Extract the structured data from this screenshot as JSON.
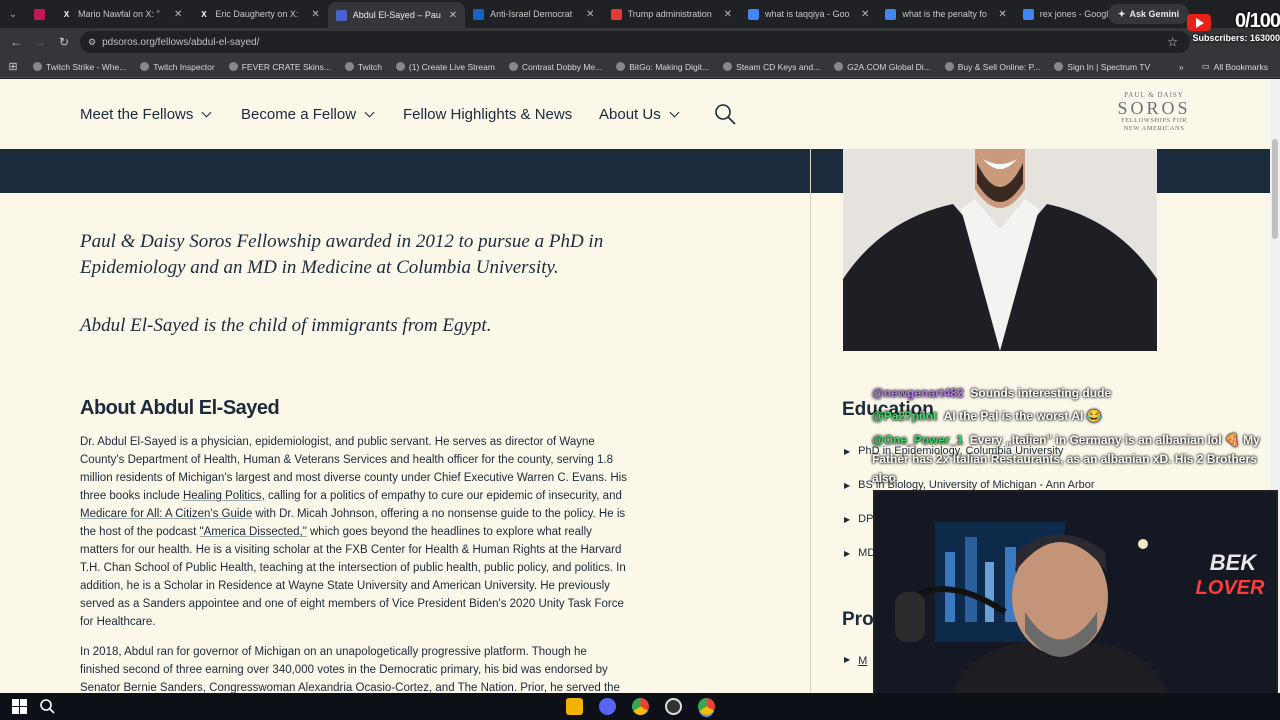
{
  "tabs": [
    {
      "label": "",
      "icon": "app-icon",
      "color": "#c2185b"
    },
    {
      "label": "Mario Nawfal on X: \"",
      "icon": "x-icon",
      "color": "#000000"
    },
    {
      "label": "Eric Daugherty on X:",
      "icon": "x-icon",
      "color": "#000000"
    },
    {
      "label": "Abdul El-Sayed – Pau",
      "icon": "pdsoros-icon",
      "color": "#4a63c7",
      "active": true
    },
    {
      "label": "Anti-Israel Democrat",
      "icon": "news-icon",
      "color": "#1565c0"
    },
    {
      "label": "Trump administration",
      "icon": "news-icon",
      "color": "#e53935"
    },
    {
      "label": "what is taqqiya - Goo",
      "icon": "google-icon",
      "color": "#4285f4"
    },
    {
      "label": "what is the penalty fo",
      "icon": "google-icon",
      "color": "#4285f4"
    },
    {
      "label": "rex jones - Google Se",
      "icon": "google-icon",
      "color": "#4285f4"
    }
  ],
  "gemini_label": "Ask Gemini",
  "url": "pdsoros.org/fellows/abdul-el-sayed/",
  "bookmarks": [
    "Twitch Strike - Whe...",
    "Twitch Inspector",
    "FEVER CRATE Skins...",
    "Twitch",
    "(1) Create Live Stream",
    "Contrast Dobby Me...",
    "BitGo: Making Digit...",
    "Steam CD Keys and...",
    "G2A.COM Global Di...",
    "Buy & Sell Online: P...",
    "Sign In | Spectrum TV"
  ],
  "all_bookmarks": "All Bookmarks",
  "site_nav": {
    "meet": "Meet the Fellows",
    "become": "Become a Fellow",
    "highlights": "Fellow Highlights & News",
    "about": "About Us"
  },
  "logo": {
    "top": "PAUL & DAISY",
    "main": "SOROS",
    "sub1": "FELLOWSHIPS FOR",
    "sub2": "NEW AMERICANS"
  },
  "main": {
    "quote1": "Paul & Daisy Soros Fellowship awarded in 2012 to pursue a PhD in Epidemiology and an MD in Medicine at Columbia University.",
    "quote2": "Abdul El-Sayed is the child of immigrants from Egypt.",
    "about_heading": "About Abdul El-Sayed",
    "p1_a": "Dr. Abdul El-Sayed is a physician, epidemiologist, and public servant. He serves as director of Wayne County's Department of Health, Human & Veterans Services and health officer for the county, serving 1.8 million residents of Michigan's largest and most diverse county under Chief Executive Warren C. Evans. His three books include ",
    "p1_link1": "Healing Politics",
    "p1_b": ", calling for a politics of empathy to cure our epidemic of insecurity, and ",
    "p1_link2": "Medicare for All: A Citizen's Guide",
    "p1_c": " with Dr. Micah Johnson, offering a no nonsense guide to the policy. He is the host of the podcast ",
    "p1_link3": "\"America Dissected,\"",
    "p1_d": " which goes beyond the headlines to explore what really matters for our health. He is a visiting scholar at the FXB Center for Health & Human Rights at the Harvard T.H. Chan School of Public Health, teaching at the intersection of public health, public policy, and politics. In addition, he is a Scholar in Residence at Wayne State University and American University. He previously served as a Sanders appointee and one of eight members of Vice President Biden's 2020 Unity Task Force for Healthcare.",
    "p2": "In 2018, Abdul ran for governor of Michigan on an unapologetically progressive platform. Though he finished second of three earning over 340,000 votes in the Democratic primary, his bid was endorsed by Senator Bernie Sanders, Congresswoman Alexandria Ocasio-Cortez, and The Nation. Prior, he served the"
  },
  "sidebar": {
    "education_heading": "Education",
    "education": [
      "PhD in Epidemiology, Columbia University",
      "BS in Biology, University of Michigan - Ann Arbor",
      "DPhil",
      "MD"
    ],
    "professional_heading": "Prof",
    "professional_item": "M"
  },
  "chat": [
    {
      "user": "@newgenart482",
      "msg": "Sounds interesting dude"
    },
    {
      "user": "@Pa27pilot",
      "msg": "AI the Pal is the worst AI 😂"
    },
    {
      "user": "@One_Power_1",
      "msg": "Every „Italien\" in Germany is an albanian lol 🍕 My Father has 2x Italian Restaurants, as an albanian xD. His 2 Brothers also"
    }
  ],
  "overlay": {
    "sub_count": "0/100",
    "subscribers": "Subscribers: 163000",
    "neon_line1": "BEK",
    "neon_line2": "LOVER"
  }
}
